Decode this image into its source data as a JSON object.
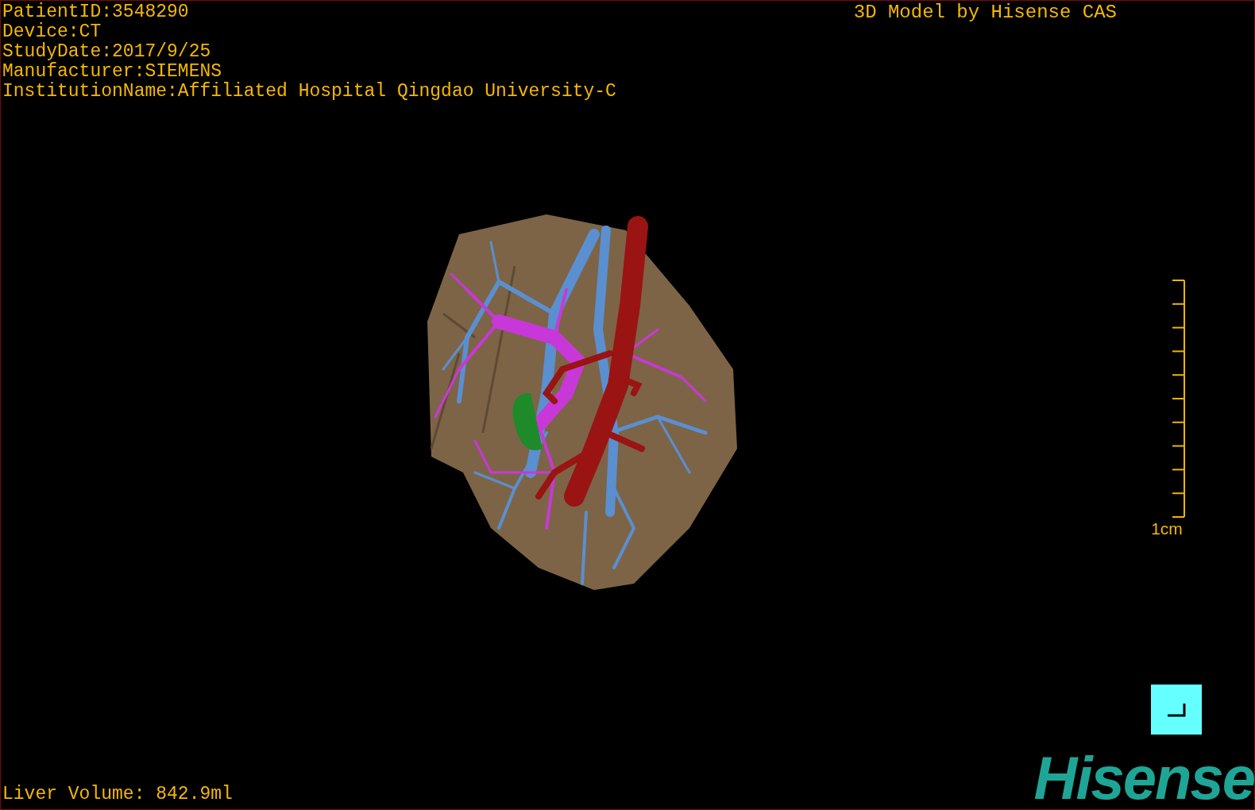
{
  "study_info": [
    "PatientID:3548290",
    "Device:CT",
    "StudyDate:2017/9/25",
    "Manufacturer:SIEMENS",
    "InstitutionName:Affiliated Hospital Qingdao University-C"
  ],
  "model_title": "3D Model by Hisense CAS",
  "scale_bar": {
    "label": "1cm"
  },
  "liver_volume": "Liver Volume: 842.9ml",
  "logo": "Hisense"
}
